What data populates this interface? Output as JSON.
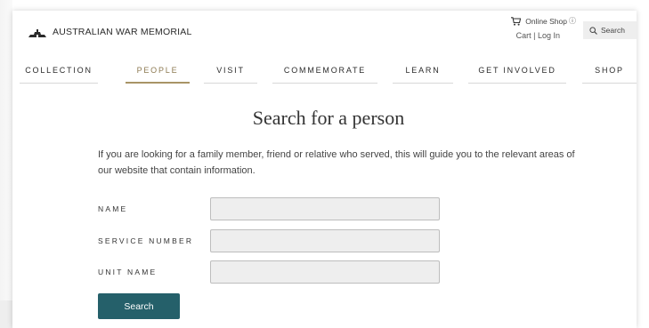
{
  "header": {
    "logo_text": "AUSTRALIAN WAR MEMORIAL",
    "online_shop_label": "Online Shop",
    "info_glyph": "ⓘ",
    "cart_login_label": "Cart | Log In",
    "search_label": "Search"
  },
  "nav": {
    "items": [
      {
        "label": "COLLECTION"
      },
      {
        "label": "PEOPLE",
        "active": true
      },
      {
        "label": "VISIT"
      },
      {
        "label": "COMMEMORATE"
      },
      {
        "label": "LEARN"
      },
      {
        "label": "GET INVOLVED"
      },
      {
        "label": "SHOP"
      }
    ]
  },
  "main": {
    "title": "Search for a person",
    "intro": "If you are looking for a family member, friend or relative who served, this will guide you to the relevant areas of our website that contain information.",
    "form": {
      "name_label": "NAME",
      "name_value": "",
      "service_number_label": "SERVICE NUMBER",
      "service_number_value": "",
      "unit_name_label": "UNIT NAME",
      "unit_name_value": "",
      "search_button_label": "Search"
    }
  },
  "icons": {
    "logo": "memorial-logo-icon",
    "cart": "shopping-cart-icon",
    "info": "info-icon",
    "search": "search-icon"
  },
  "colors": {
    "accent_nav": "#8d7a52",
    "button": "#25606a",
    "input_bg": "#eeeeee"
  }
}
